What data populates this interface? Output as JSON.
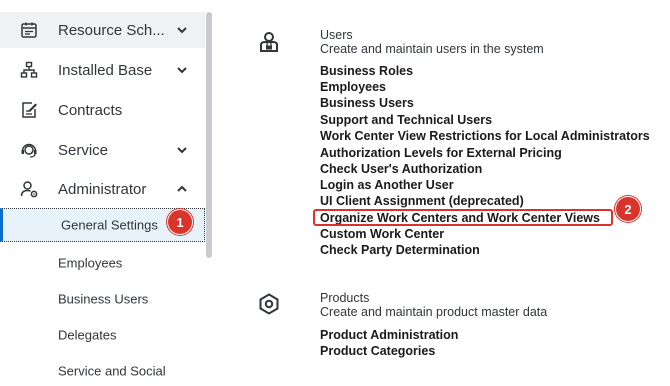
{
  "sidebar": {
    "items": [
      {
        "label": "Resource Sch...",
        "icon": "calendar-icon",
        "chevron": "down"
      },
      {
        "label": "Installed Base",
        "icon": "hierarchy-icon",
        "chevron": "down"
      },
      {
        "label": "Contracts",
        "icon": "edit-document-icon",
        "chevron": ""
      },
      {
        "label": "Service",
        "icon": "headset-icon",
        "chevron": "down"
      },
      {
        "label": "Administrator",
        "icon": "user-settings-icon",
        "chevron": "up"
      }
    ],
    "sub_items": [
      {
        "label": "General Settings"
      },
      {
        "label": "Employees"
      },
      {
        "label": "Business Users"
      },
      {
        "label": "Delegates"
      },
      {
        "label": "Service and Social"
      }
    ]
  },
  "annotations": {
    "badge1": "1",
    "badge2": "2",
    "color": "#d9342b"
  },
  "groups": {
    "users": {
      "title": "Users",
      "description": "Create and maintain users in the system",
      "icon": "user-lock-icon",
      "links": [
        "Business Roles",
        "Employees",
        "Business Users",
        "Support and Technical Users",
        "Work Center View Restrictions for Local Administrators",
        "Authorization Levels for External Pricing",
        "Check User's Authorization",
        "Login as Another User",
        "UI Client Assignment (deprecated)",
        "Organize Work Centers and Work Center Views",
        "Custom Work Center",
        "Check Party Determination"
      ]
    },
    "products": {
      "title": "Products",
      "description": "Create and maintain product master data",
      "icon": "product-icon",
      "links": [
        "Product Administration",
        "Product Categories"
      ]
    }
  }
}
